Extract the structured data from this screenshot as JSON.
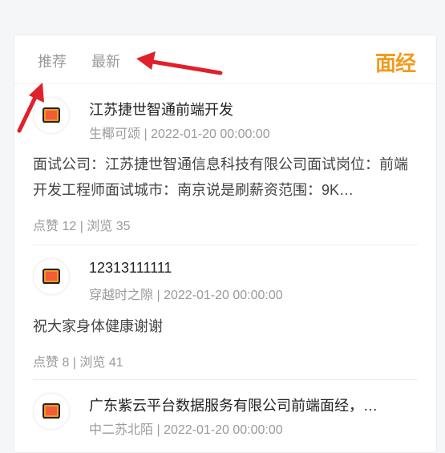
{
  "tabs": [
    {
      "label": "推荐"
    },
    {
      "label": "最新"
    }
  ],
  "logo_text": "面经",
  "colors": {
    "accent": "#f39a1a",
    "annotation": "#e0202a"
  },
  "posts": [
    {
      "title": "江苏捷世智通前端开发",
      "author": "生椰可颂",
      "date": "2022-01-20 00:00:00",
      "content": "面试公司：江苏捷世智通信息科技有限公司面试岗位：前端开发工程师面试城市：南京说是刷薪资范围：9K…",
      "stats": "点赞 12 | 浏览 35"
    },
    {
      "title": "12313111111",
      "author": "穿越时之隙",
      "date": "2022-01-20 00:00:00",
      "content": "祝大家身体健康谢谢",
      "stats": "点赞 8 | 浏览 41"
    },
    {
      "title": "广东紫云平台数据服务有限公司前端面经，…",
      "author": "中二苏北陌",
      "date": "2022-01-20 00:00:00"
    }
  ]
}
